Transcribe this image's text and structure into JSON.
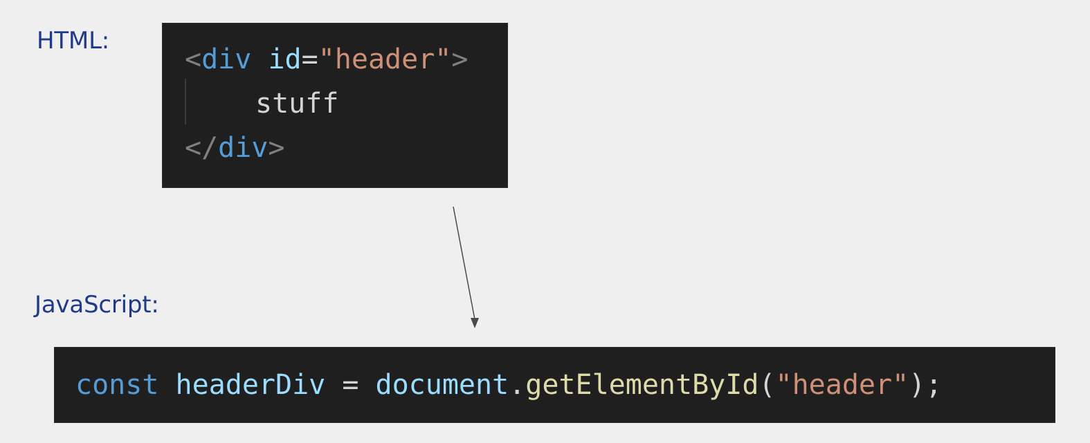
{
  "labels": {
    "html": "HTML:",
    "javascript": "JavaScript:"
  },
  "html_code": {
    "line1": {
      "open_angle": "<",
      "tag": "div",
      "space": " ",
      "attr": "id",
      "equals": "=",
      "value": "\"header\"",
      "close_angle": ">"
    },
    "line2": {
      "text": "stuff"
    },
    "line3": {
      "open_angle": "</",
      "tag": "div",
      "close_angle": ">"
    }
  },
  "js_code": {
    "line1": {
      "keyword": "const",
      "space1": " ",
      "var_name": "headerDiv",
      "assign": " = ",
      "object": "document",
      "dot": ".",
      "method": "getElementById",
      "paren_open": "(",
      "arg": "\"header\"",
      "paren_close_semicolon": ");"
    },
    "line2_partial": "              "
  },
  "colors": {
    "background": "#efefef",
    "label": "#1f3a8a",
    "code_bg": "#1f1f1f",
    "tag": "#569cd6",
    "attr": "#9cdcfe",
    "string": "#ce9178",
    "function": "#dcdcaa",
    "punctuation": "#808080"
  }
}
